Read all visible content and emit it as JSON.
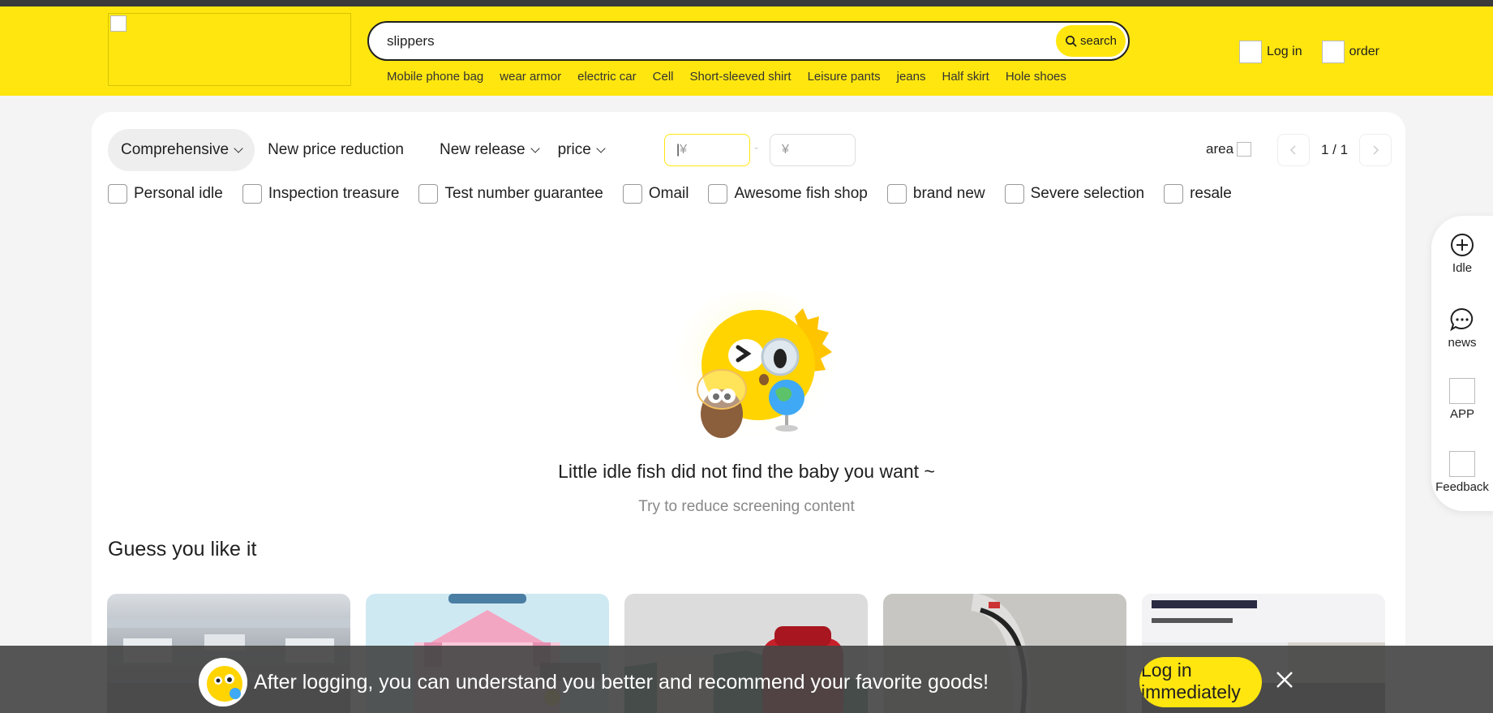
{
  "header": {
    "search_value": "slippers",
    "search_button": "search",
    "hot_words": [
      "Mobile phone bag",
      "wear armor",
      "electric car",
      "Cell",
      "Short-sleeved shirt",
      "Leisure pants",
      "jeans",
      "Half skirt",
      "Hole shoes"
    ],
    "login_label": "Log in",
    "order_label": "order"
  },
  "sort": {
    "comprehensive": "Comprehensive",
    "new_price_reduction": "New price reduction",
    "new_release": "New release",
    "price": "price",
    "min_price_placeholder": "¥",
    "max_price_placeholder": "¥",
    "area": "area",
    "page_indicator": "1 / 1"
  },
  "filters": [
    "Personal idle",
    "Inspection treasure",
    "Test number guarantee",
    "Omail",
    "Awesome fish shop",
    "brand new",
    "Severe selection",
    "resale"
  ],
  "empty_state": {
    "title": "Little idle fish did not find the baby you want ~",
    "subtitle": "Try to reduce screening content"
  },
  "guess": {
    "title": "Guess you like it"
  },
  "sidebar": {
    "idle": "Idle",
    "news": "news",
    "app": "APP",
    "feedback": "Feedback"
  },
  "banner": {
    "text": "After logging, you can understand you better and recommend your favorite goods!",
    "login_now": "Log in immediately"
  },
  "colors": {
    "brand_yellow": "#ffe60f",
    "banner_bg": "#464646"
  }
}
